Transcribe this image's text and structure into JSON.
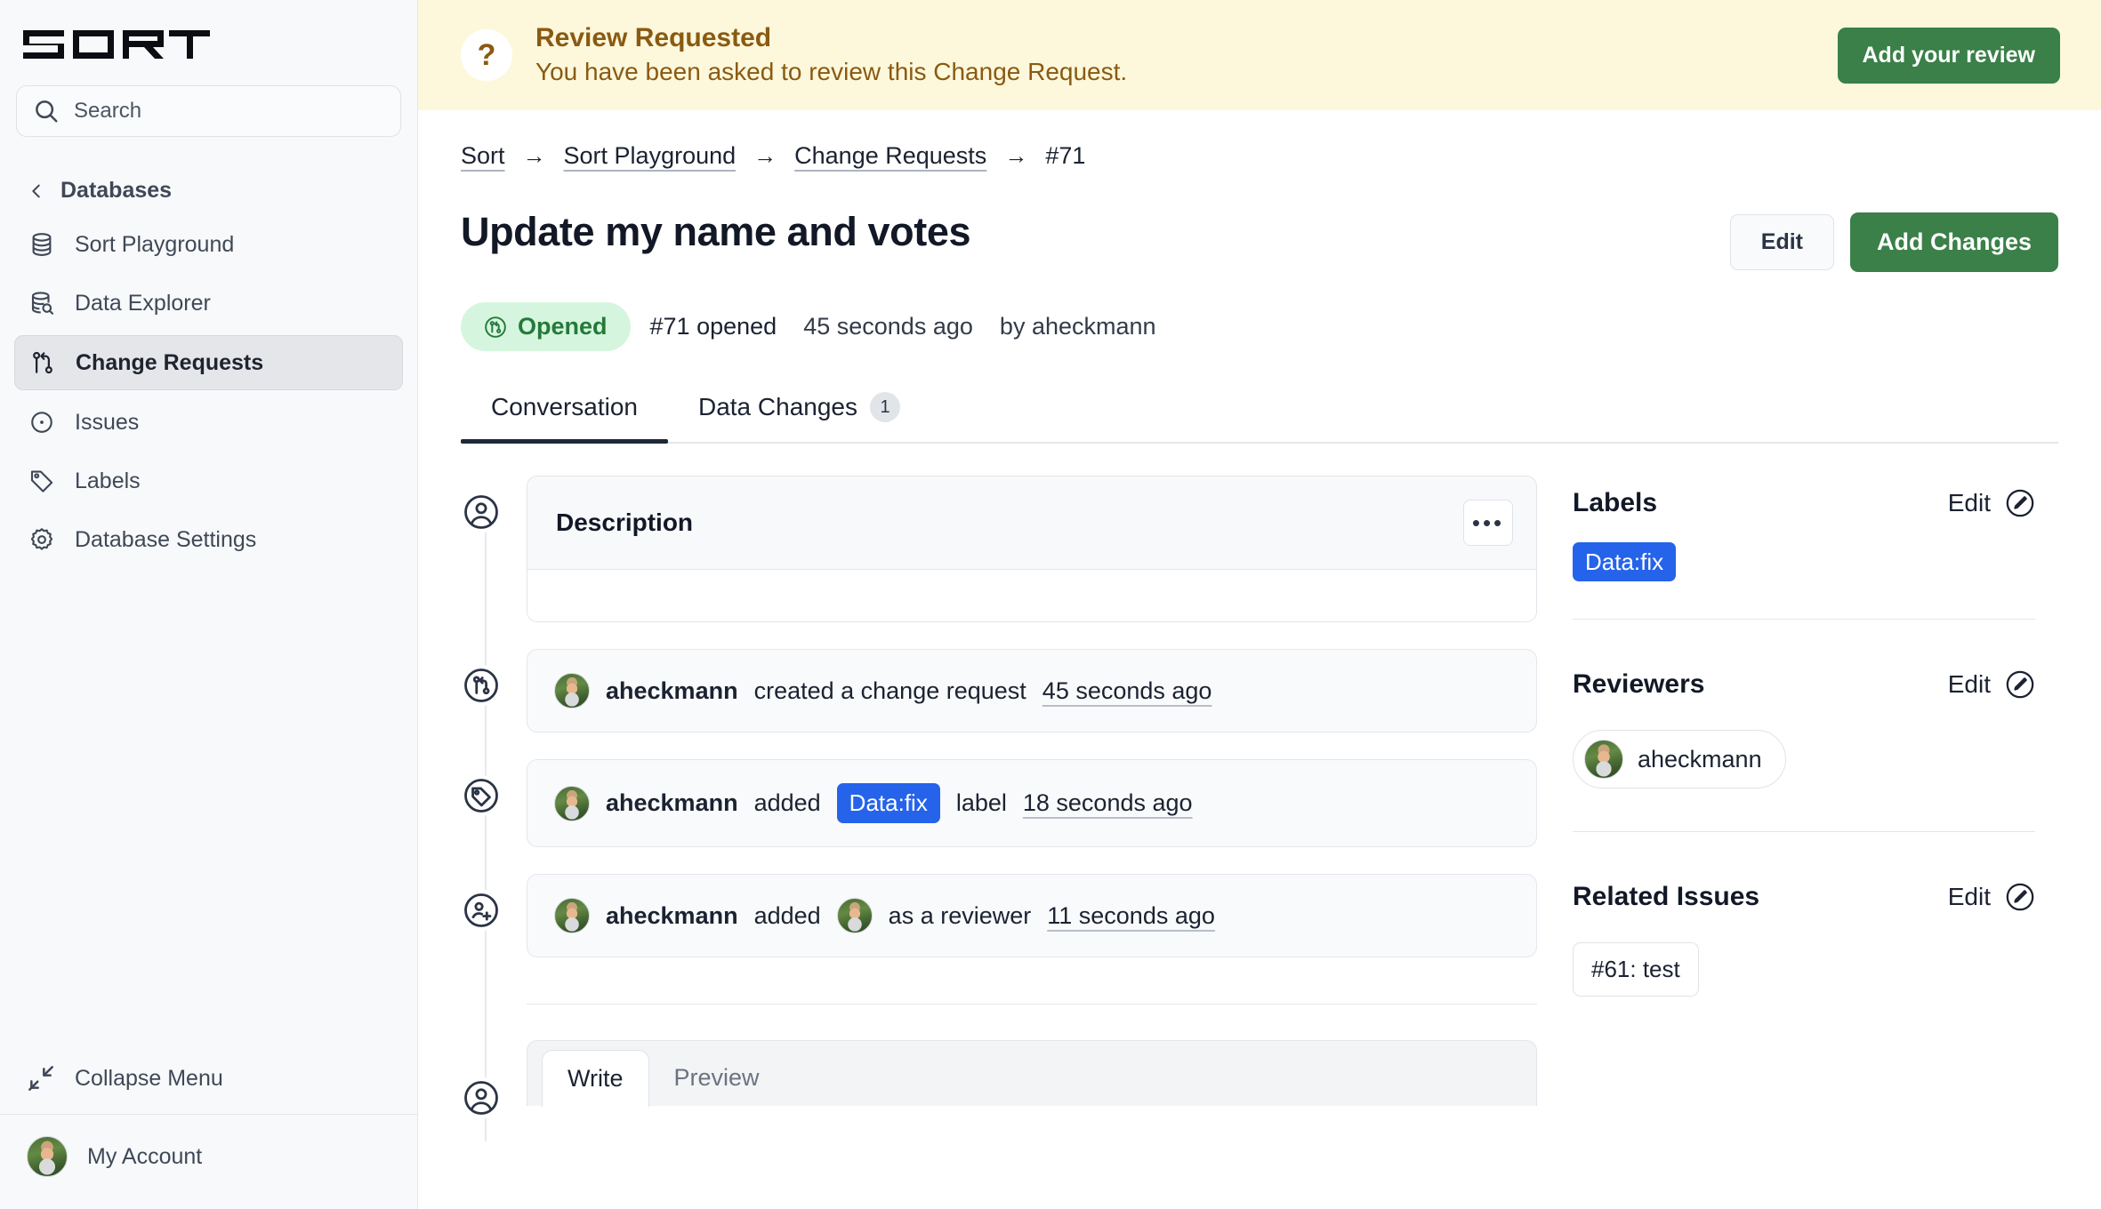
{
  "sidebar": {
    "logo_text": "SORT",
    "search": {
      "placeholder": "Search"
    },
    "back_label": "Databases",
    "items": [
      {
        "label": "Sort Playground",
        "icon": "database-icon"
      },
      {
        "label": "Data Explorer",
        "icon": "database-search-icon"
      },
      {
        "label": "Change Requests",
        "icon": "pull-request-icon"
      },
      {
        "label": "Issues",
        "icon": "issue-dot-icon"
      },
      {
        "label": "Labels",
        "icon": "tag-icon"
      },
      {
        "label": "Database Settings",
        "icon": "gear-icon"
      }
    ],
    "active_item": "Change Requests",
    "collapse_label": "Collapse Menu",
    "account_label": "My Account"
  },
  "banner": {
    "icon": "question-mark-icon",
    "title": "Review Requested",
    "subtitle": "You have been asked to review this Change Request.",
    "action_label": "Add your review",
    "bg_color": "#fdf8dc",
    "text_color": "#8a5a12",
    "button_color": "#3a8048"
  },
  "breadcrumb": [
    {
      "label": "Sort",
      "is_last": false
    },
    {
      "label": "Sort Playground",
      "is_last": false
    },
    {
      "label": "Change Requests",
      "is_last": false
    },
    {
      "label": "#71",
      "is_last": true
    }
  ],
  "breadcrumb_separator": "→",
  "header": {
    "title": "Update my name and votes",
    "edit_label": "Edit",
    "add_changes_label": "Add Changes"
  },
  "meta": {
    "status_badge": "Opened",
    "status_icon": "pull-request-icon",
    "status_color": "#237a3a",
    "status_bg": "#d6f5de",
    "number_text": "#71 opened",
    "time_text": "45 seconds ago",
    "author_text": "by aheckmann"
  },
  "tabs": [
    {
      "label": "Conversation",
      "count": null,
      "active": true
    },
    {
      "label": "Data Changes",
      "count": "1",
      "active": false
    }
  ],
  "timeline": {
    "description_card": {
      "icon": "person-circle-icon",
      "title": "Description",
      "menu_label": "•••",
      "body": ""
    },
    "events": [
      {
        "icon": "pull-request-circle-icon",
        "actor": "aheckmann",
        "action_before": "created a change request",
        "chip": null,
        "action_after": "",
        "avatar_inline": false,
        "timestamp": "45 seconds ago"
      },
      {
        "icon": "tag-circle-icon",
        "actor": "aheckmann",
        "action_before": "added",
        "chip": "Data:fix",
        "action_after": "label",
        "avatar_inline": false,
        "timestamp": "18 seconds ago"
      },
      {
        "icon": "person-add-circle-icon",
        "actor": "aheckmann",
        "action_before": "added",
        "chip": null,
        "action_after": "as a reviewer",
        "avatar_inline": true,
        "timestamp": "11 seconds ago"
      }
    ]
  },
  "composer": {
    "icon": "person-circle-icon",
    "tabs": [
      {
        "label": "Write",
        "active": true
      },
      {
        "label": "Preview",
        "active": false
      }
    ]
  },
  "side_panel": {
    "labels": {
      "title": "Labels",
      "edit_label": "Edit",
      "edit_icon": "pencil-circle-icon",
      "chips": [
        {
          "text": "Data:fix",
          "color": "#2563eb"
        }
      ]
    },
    "reviewers": {
      "title": "Reviewers",
      "edit_label": "Edit",
      "edit_icon": "pencil-circle-icon",
      "people": [
        {
          "name": "aheckmann"
        }
      ]
    },
    "related_issues": {
      "title": "Related Issues",
      "edit_label": "Edit",
      "edit_icon": "pencil-circle-icon",
      "issues": [
        {
          "text": "#61: test"
        }
      ]
    }
  }
}
